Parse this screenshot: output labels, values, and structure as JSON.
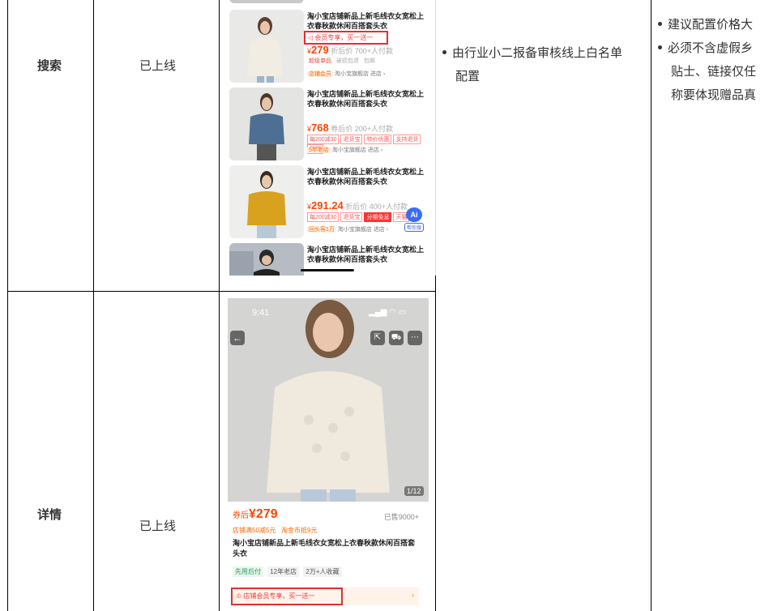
{
  "rows": [
    {
      "name": "搜索",
      "status": "已上线",
      "notes": [
        "由行业小二报备审核线上白名单",
        "配置"
      ]
    },
    {
      "name": "详情",
      "status": "已上线"
    }
  ],
  "requirements": [
    "建议配置价格大",
    "必须不含虚假乡",
    "贴士、链接仅任",
    "称要体现赠品真"
  ],
  "search_mock": {
    "items": [
      {
        "title": "淘小宝店铺新品上新毛线衣女宽松上衣春秋款休闲百搭套头衣",
        "promo": "◁ 会员专享，买一送一",
        "price_prefix": "¥",
        "price": "279",
        "price_note": "折后价 700+人付款",
        "tags": [
          "超级单品",
          "破损包退",
          "包邮"
        ],
        "shop_tag": "店铺会员",
        "shop": "淘小宝旗舰店 进店 ›"
      },
      {
        "title": "淘小宝店铺新品上新毛线衣女宽松上衣春秋款休闲百搭套头衣",
        "price_prefix": "¥",
        "price": "768",
        "price_note": "券后价 200+人付款",
        "tags": [
          "每200减30",
          "退货宝",
          "特价优惠",
          "支持退货",
          "包邮"
        ],
        "shop_tag": "5年老店",
        "shop": "淘小宝旗舰店 进店 ›"
      },
      {
        "title": "淘小宝店铺新品上新毛线衣女宽松上衣春秋款休闲百搭套头衣",
        "price_prefix": "¥",
        "price": "291.24",
        "price_note": "折后价 400+人付款",
        "tags": [
          "每200减30",
          "退货宝",
          "分期免息",
          "天猫"
        ],
        "shop_tag": "回头客1万",
        "shop": "淘小宝旗舰店 进店 ›",
        "ai_badge": "Ai",
        "ai_label": "帮你搜"
      },
      {
        "title": "淘小宝店铺新品上新毛线衣女宽松上衣春秋款休闲百搭套头衣"
      }
    ]
  },
  "detail_mock": {
    "status_time": "9:41",
    "image_counter": "1/12",
    "price_prefix": "券后",
    "price": "¥279",
    "sold": "已售9000+",
    "coupons": "店铺满50减5元   淘金币抵9元",
    "title": "淘小宝店铺新品上新毛线衣女宽松上衣春秋款休闲百搭套头衣",
    "badges": [
      "先用后付",
      "12年老店",
      "2万+人收藏"
    ],
    "promo": "店铺会员专享，买一送一"
  }
}
